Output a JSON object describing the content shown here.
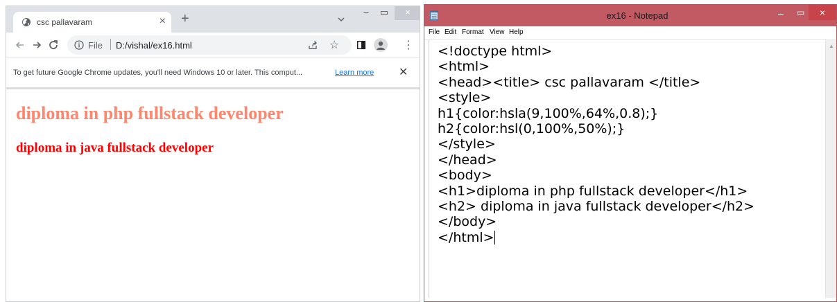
{
  "browser": {
    "tab": {
      "title": "csc pallavaram",
      "close_glyph": "×",
      "favicon": "globe-icon"
    },
    "new_tab_glyph": "+",
    "window_controls": {
      "minimize": "–",
      "maximize": "▭",
      "close": "×"
    },
    "address_bar": {
      "scheme_label": "File",
      "url": "D:/vishal/ex16.html"
    },
    "infobar": {
      "message": "To get future Google Chrome updates, you'll need Windows 10 or later. This comput...",
      "link": "Learn more",
      "close_glyph": "✕"
    },
    "page": {
      "h1": "diploma in php fullstack developer",
      "h2": "diploma in java fullstack developer",
      "h1_color": "#ff6647",
      "h2_color": "#ff0000"
    }
  },
  "notepad": {
    "title": "ex16 - Notepad",
    "titlebar_color": "#c15a62",
    "window_controls": {
      "minimize": "–",
      "maximize": "▭",
      "close": "×"
    },
    "menu": [
      "File",
      "Edit",
      "Format",
      "View",
      "Help"
    ],
    "lines": [
      "<!doctype html>",
      "<html>",
      "<head><title> csc pallavaram </title>",
      "<style>",
      "h1{color:hsla(9,100%,64%,0.8);}",
      "h2{color:hsl(0,100%,50%);}",
      "</style>",
      "</head>",
      "<body>",
      "<h1>diploma in php fullstack developer</h1>",
      "<h2> diploma in java fullstack developer</h2>",
      "</body>",
      "</html>"
    ]
  }
}
